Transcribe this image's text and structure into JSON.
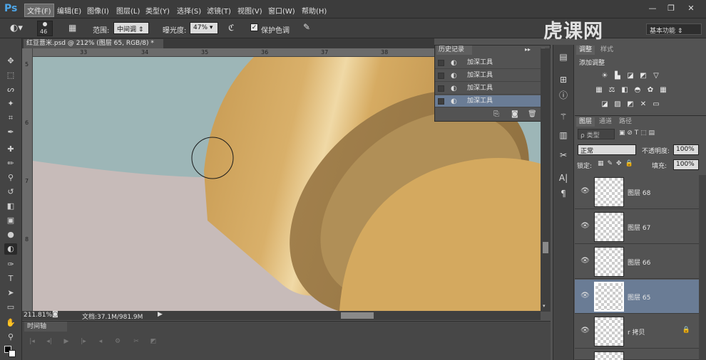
{
  "app": {
    "logo": "Ps"
  },
  "menu": {
    "items": [
      "文件(F)",
      "编辑(E)",
      "图像(I)",
      "图层(L)",
      "类型(Y)",
      "选择(S)",
      "滤镜(T)",
      "视图(V)",
      "窗口(W)",
      "帮助(H)"
    ],
    "active_index": 0
  },
  "window_controls": {
    "minimize": "—",
    "restore": "❐",
    "close": "✕"
  },
  "options": {
    "brush_size": "46",
    "range_label": "范围:",
    "range_value": "中间调",
    "exposure_label": "曝光度:",
    "exposure_value": "47%",
    "protect_tones_label": "保护色调",
    "protect_tones_checked": "✓"
  },
  "watermark": {
    "text": "虎课网"
  },
  "workspace": {
    "label": "基本功能"
  },
  "document": {
    "tab_title": "红豆薏米.psd @ 212% (图层 65, RGB/8) *",
    "close": "×"
  },
  "rulers": {
    "top": [
      "33",
      "34",
      "35",
      "36",
      "37",
      "38"
    ],
    "left": [
      "5",
      "6",
      "7",
      "8"
    ]
  },
  "status": {
    "zoom": "211.81%",
    "doc_size": "文档:37.1M/981.9M"
  },
  "timeline": {
    "label": "时间轴"
  },
  "history": {
    "title": "历史记录",
    "items": [
      {
        "label": "加深工具"
      },
      {
        "label": "加深工具"
      },
      {
        "label": "加深工具"
      },
      {
        "label": "加深工具"
      }
    ],
    "selected_index": 3
  },
  "adjustments": {
    "tabs": [
      "调整",
      "样式"
    ],
    "title": "添加调整"
  },
  "layers": {
    "tabs": [
      "图层",
      "通道",
      "路径"
    ],
    "filter_placeholder": "ρ 类型",
    "blend_mode": "正常",
    "opacity_label": "不透明度:",
    "opacity_value": "100%",
    "lock_label": "锁定:",
    "fill_label": "填充:",
    "fill_value": "100%",
    "items": [
      {
        "name": "图层 68"
      },
      {
        "name": "图层 67"
      },
      {
        "name": "图层 66"
      },
      {
        "name": "图层 65"
      },
      {
        "name": "r 拷贝"
      }
    ],
    "selected_index": 3
  },
  "colors": {
    "accent_selected": "#6a7c95",
    "canvas_bg_teal": "#9db6b7",
    "canvas_floor": "#c7bbb9",
    "cylinder_gold": "#d4a95f"
  }
}
